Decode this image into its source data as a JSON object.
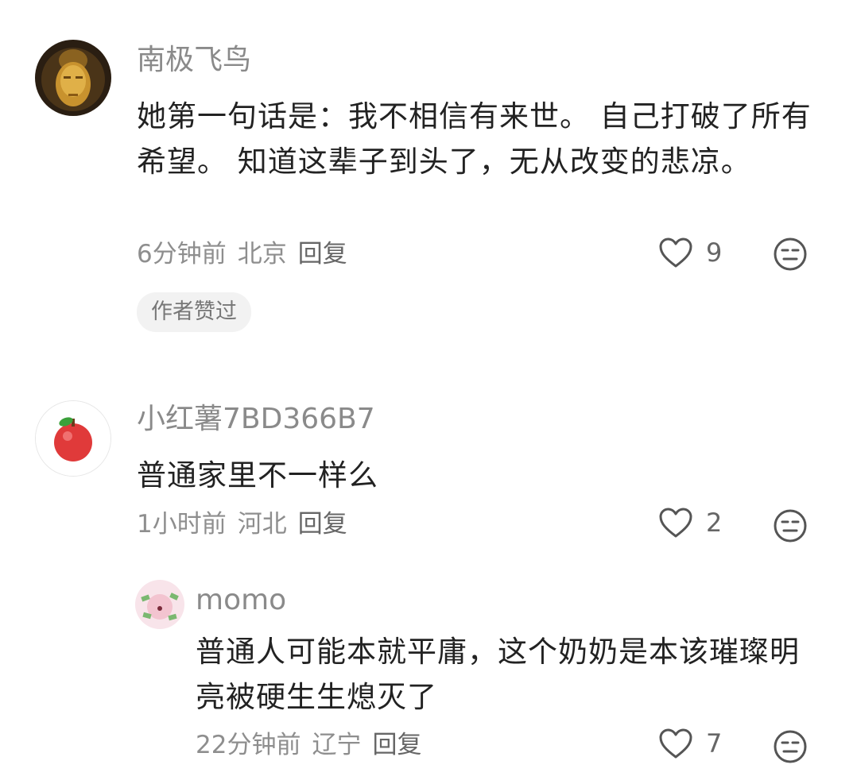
{
  "comments": [
    {
      "username": "南极飞鸟",
      "text": "她第一句话是：我不相信有来世。 自己打破了所有希望。 知道这辈子到头了，无从改变的悲凉。",
      "time": "6分钟前",
      "location": "北京",
      "reply": "回复",
      "likes": "9",
      "badge": "作者赞过"
    },
    {
      "username": "小红薯7BD366B7",
      "text": "普通家里不一样么",
      "time": "1小时前",
      "location": "河北",
      "reply": "回复",
      "likes": "2",
      "replies": [
        {
          "username": "momo",
          "text": "普通人可能本就平庸，这个奶奶是本该璀璨明亮被硬生生熄灭了",
          "time": "22分钟前",
          "location": "辽宁",
          "reply": "回复",
          "likes": "7"
        }
      ]
    }
  ],
  "icons": {
    "like": "heart-outline-icon",
    "emoji": "neutral-face-icon"
  }
}
